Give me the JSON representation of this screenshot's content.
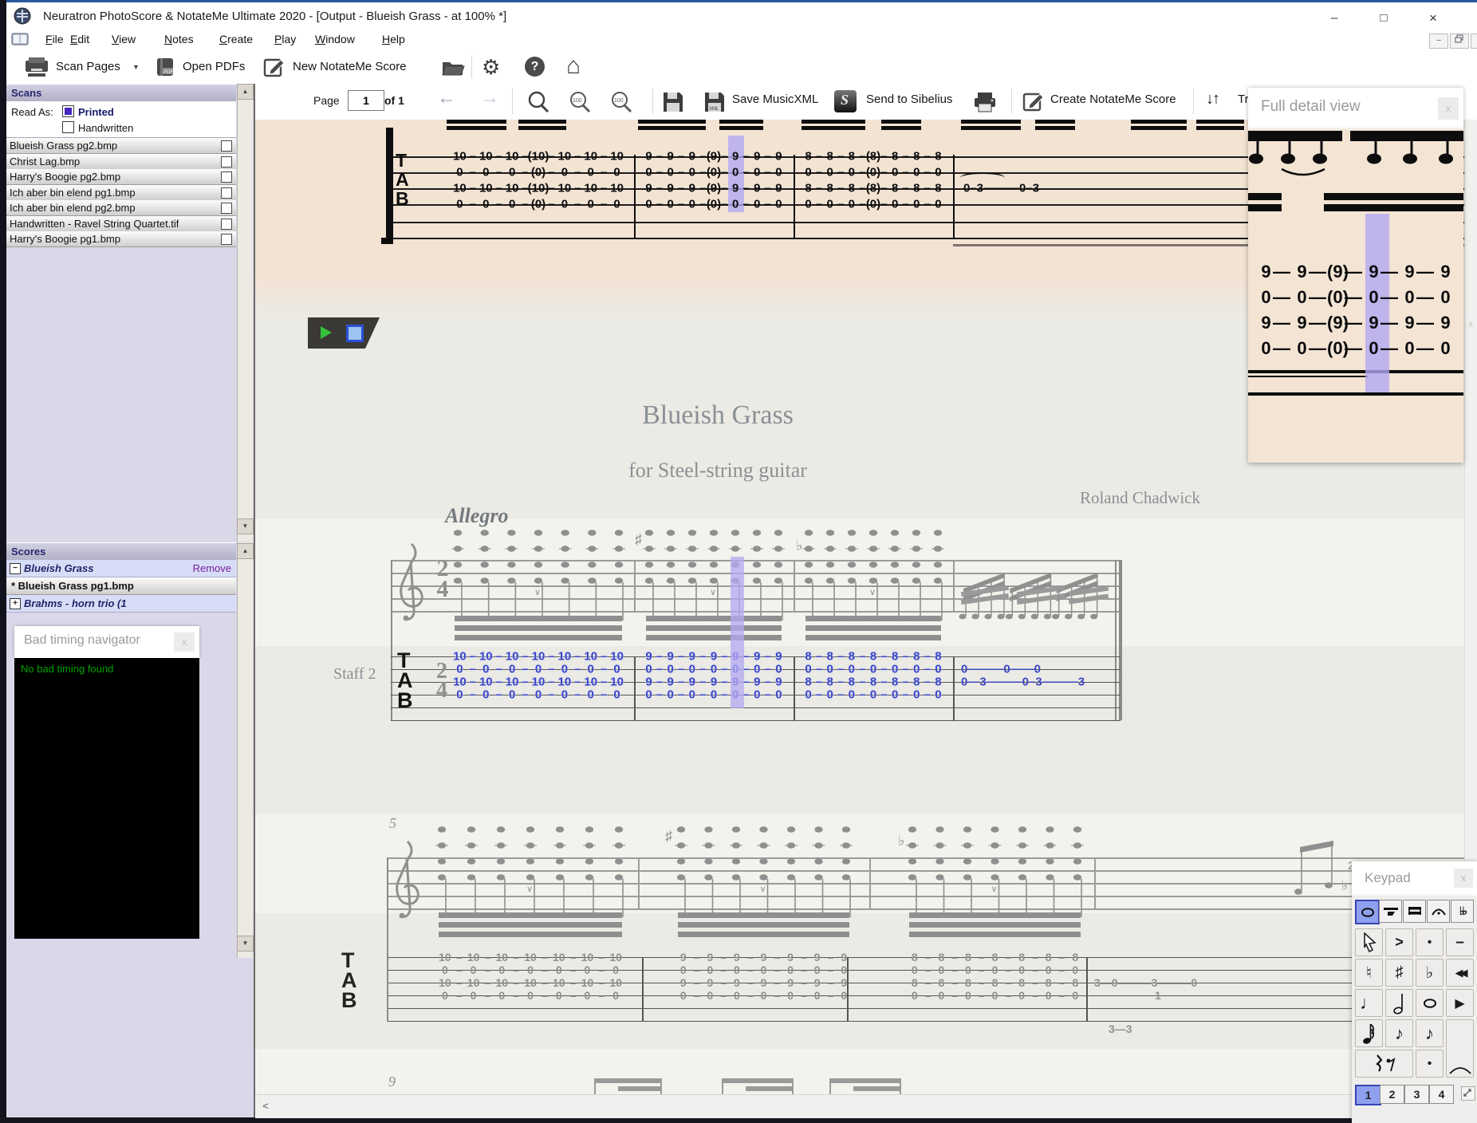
{
  "window": {
    "title": "Neuratron PhotoScore & NotateMe Ultimate 2020 - [Output - Blueish Grass - at 100% *]",
    "controls": {
      "minimize": "–",
      "maximize": "□",
      "close": "×"
    },
    "mdi_controls": {
      "minimize": "–",
      "restore": "❐",
      "close": "×"
    }
  },
  "menu_bar": {
    "items": [
      "File",
      "Edit",
      "View",
      "Notes",
      "Create",
      "Play",
      "Window",
      "Help"
    ]
  },
  "toolbar": {
    "scan_pages": "Scan Pages",
    "open_pdfs": "Open PDFs",
    "new_notateme_score": "New NotateMe Score"
  },
  "view_toolbar": {
    "page_label": "Page",
    "page_value": "1",
    "page_of": "of 1",
    "save_musicxml": "Save MusicXML",
    "send_to_sibelius": "Send to Sibelius",
    "create_notateme_score": "Create NotateMe Score",
    "transpose_clipped": "Tra"
  },
  "icons": {
    "gear": "⚙",
    "help": "?",
    "home": "⌂",
    "dropdown": "▼",
    "back": "←",
    "forward": "→",
    "transpose": "↓↑",
    "scroll_up": "▲",
    "scroll_down": "▼",
    "scroll_left": "<",
    "chevron_up": "∧",
    "panel_close": "x"
  },
  "scans_panel": {
    "header": "Scans",
    "read_as_label": "Read As:",
    "printed_label": "Printed",
    "printed_checked": true,
    "handwritten_label": "Handwritten",
    "handwritten_checked": false,
    "files": [
      "Blueish Grass pg2.bmp",
      "Christ Lag.bmp",
      "Harry's Boogie pg2.bmp",
      "Ich aber bin elend pg1.bmp",
      "Ich aber bin elend pg2.bmp",
      "Handwritten - Ravel String Quartet.tif",
      "Harry's Boogie pg1.bmp"
    ]
  },
  "scores_panel": {
    "header": "Scores",
    "items": [
      {
        "label": "Blueish Grass",
        "expander": "−",
        "action": "Remove",
        "style": "blue-italic"
      },
      {
        "label": "* Blueish Grass pg1.bmp",
        "expander": "",
        "action": "",
        "style": "gray-bold"
      },
      {
        "label": "Brahms - horn trio (1",
        "expander": "+",
        "action": "",
        "style": "blue-italic"
      }
    ]
  },
  "bad_timing_navigator": {
    "title": "Bad timing navigator",
    "message": "No bad timing found"
  },
  "score": {
    "title": "Blueish Grass",
    "subtitle": "for Steel-string guitar",
    "composer": "Roland Chadwick",
    "tempo": "Allegro",
    "staff_label": "Staff 2",
    "tab_letters": [
      "T",
      "A",
      "B"
    ],
    "time_signature": {
      "upper": "2",
      "lower": "4"
    },
    "measure_number_5": "5",
    "measure_number_9": "9",
    "scan_tab_measures": [
      [
        [
          "10",
          "10",
          "10",
          "(10)",
          "10",
          "10",
          "10"
        ],
        [
          "0",
          "0",
          "0",
          "(0)",
          "0",
          "0",
          "0"
        ],
        [
          "10",
          "10",
          "10",
          "(10)",
          "10",
          "10",
          "10"
        ],
        [
          "0",
          "0",
          "0",
          "(0)",
          "0",
          "0",
          "0"
        ]
      ],
      [
        [
          "9",
          "9",
          "9",
          "(9)",
          "9",
          "9",
          "9"
        ],
        [
          "0",
          "0",
          "0",
          "(0)",
          "0",
          "0",
          "0"
        ],
        [
          "9",
          "9",
          "9",
          "(9)",
          "9",
          "9",
          "9"
        ],
        [
          "0",
          "0",
          "0",
          "(0)",
          "0",
          "0",
          "0"
        ]
      ],
      [
        [
          "8",
          "8",
          "8",
          "(8)",
          "8",
          "8",
          "8"
        ],
        [
          "0",
          "0",
          "0",
          "(0)",
          "0",
          "0",
          "0"
        ],
        [
          "8",
          "8",
          "8",
          "(8)",
          "8",
          "8",
          "8"
        ],
        [
          "0",
          "0",
          "0",
          "(0)",
          "0",
          "0",
          "0"
        ]
      ]
    ],
    "scan_sparse": "0–3———0–3",
    "staff2_tab_measures": [
      [
        [
          "10",
          "10",
          "10",
          "10",
          "10",
          "10",
          "10"
        ],
        [
          "0",
          "0",
          "0",
          "0",
          "0",
          "0",
          "0"
        ],
        [
          "10",
          "10",
          "10",
          "10",
          "10",
          "10",
          "10"
        ],
        [
          "0",
          "0",
          "0",
          "0",
          "0",
          "0",
          "0"
        ]
      ],
      [
        [
          "9",
          "9",
          "9",
          "9",
          "9",
          "9",
          "9"
        ],
        [
          "0",
          "0",
          "0",
          "0",
          "0",
          "0",
          "0"
        ],
        [
          "9",
          "9",
          "9",
          "9",
          "9",
          "9",
          "9"
        ],
        [
          "0",
          "0",
          "0",
          "0",
          "0",
          "0",
          "0"
        ]
      ],
      [
        [
          "8",
          "8",
          "8",
          "8",
          "8",
          "8",
          "8"
        ],
        [
          "0",
          "0",
          "0",
          "0",
          "0",
          "0",
          "0"
        ],
        [
          "8",
          "8",
          "8",
          "8",
          "8",
          "8",
          "8"
        ],
        [
          "0",
          "0",
          "0",
          "0",
          "0",
          "0",
          "0"
        ]
      ]
    ],
    "staff2_sparse_row2": "0———0——0",
    "staff2_sparse_row3": "0—3———0–3———3",
    "system2_tab_measures": [
      [
        [
          "10",
          "10",
          "10",
          "10",
          "10",
          "10",
          "10"
        ],
        [
          "0",
          "0",
          "0",
          "0",
          "0",
          "0",
          "0"
        ],
        [
          "10",
          "10",
          "10",
          "10",
          "10",
          "10",
          "10"
        ],
        [
          "0",
          "0",
          "0",
          "0",
          "0",
          "0",
          "0"
        ]
      ],
      [
        [
          "9",
          "9",
          "9",
          "9",
          "9",
          "9",
          "9"
        ],
        [
          "0",
          "0",
          "0",
          "0",
          "0",
          "0",
          "0"
        ],
        [
          "9",
          "9",
          "9",
          "9",
          "9",
          "9",
          "9"
        ],
        [
          "0",
          "0",
          "0",
          "0",
          "0",
          "0",
          "0"
        ]
      ],
      [
        [
          "8",
          "8",
          "8",
          "8",
          "8",
          "8",
          "8"
        ],
        [
          "0",
          "0",
          "0",
          "0",
          "0",
          "0",
          "0"
        ],
        [
          "8",
          "8",
          "8",
          "8",
          "8",
          "8",
          "8"
        ],
        [
          "0",
          "0",
          "0",
          "0",
          "0",
          "0",
          "0"
        ]
      ]
    ],
    "system2_sparse_a": "3—0———3———0",
    "system2_sparse_b": "1",
    "system2_sparse_c": "3—3",
    "accidental_sharp": "♯",
    "accidental_flat": "♭"
  },
  "full_detail_panel": {
    "title": "Full detail view",
    "tab_rows": [
      [
        "9",
        "9",
        "(9)",
        "9",
        "9",
        "9"
      ],
      [
        "0",
        "0",
        "(0)",
        "0",
        "0",
        "0"
      ],
      [
        "9",
        "9",
        "(9)",
        "9",
        "9",
        "9"
      ],
      [
        "0",
        "0",
        "(0)",
        "0",
        "0",
        "0"
      ]
    ]
  },
  "keypad_panel": {
    "title": "Keypad",
    "tabs": [
      "whole-note",
      "tenuto-note",
      "beams",
      "fermata",
      "double-flat"
    ],
    "selected_tab": 0,
    "cells": [
      "cursor",
      "accent",
      "staccato",
      "tenuto",
      "natural",
      "sharp",
      "flat",
      "rewind",
      "quarter-note",
      "half-note",
      "whole-note",
      "play",
      "sixteenth-note",
      "eighth-note",
      "eighth-note-alt",
      "slur",
      "rests",
      "staccato-dot"
    ],
    "numbers": [
      "1",
      "2",
      "3",
      "4"
    ],
    "selected_number": "1"
  },
  "colors": {
    "highlight": "#b3a8f2",
    "selection_blue": "#8fa0ee",
    "tab_number_blue": "#3b45c4",
    "scan_background": "#f3e3d3",
    "sidebar_background": "#d9d7e8",
    "bad_timing_green": "#00a400"
  }
}
